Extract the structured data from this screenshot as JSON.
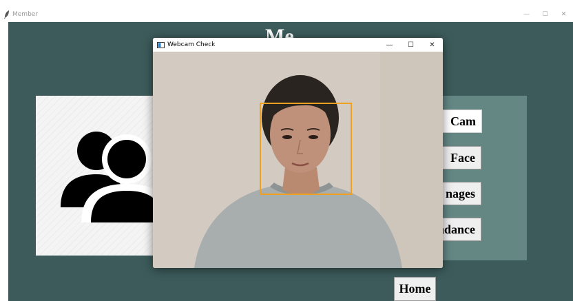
{
  "main_window": {
    "title": "Member",
    "heading": "Me",
    "controls": {
      "minimize": "—",
      "maximize": "☐",
      "close": "✕"
    }
  },
  "buttons": {
    "cam": "Cam",
    "face": "Face",
    "images": "nages",
    "attendance": "ndance",
    "home": "Home"
  },
  "webcam_window": {
    "title": "Webcam Check",
    "controls": {
      "minimize": "—",
      "maximize": "☐",
      "close": "✕"
    }
  },
  "colors": {
    "background": "#3c5b5a",
    "button_panel": "#648784",
    "face_box": "#f0a01e"
  },
  "icons": {
    "image_panel": "users-group-icon"
  }
}
